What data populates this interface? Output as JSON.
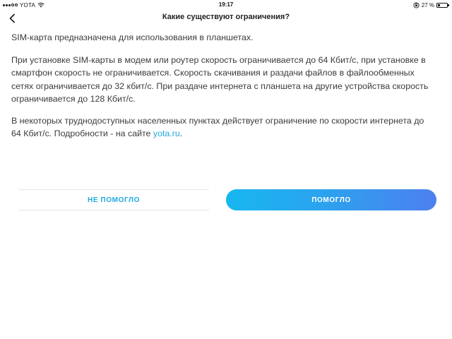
{
  "status_bar": {
    "carrier": "YOTA",
    "time": "19:17",
    "battery_percent": "27 %",
    "battery_level": 0.27,
    "icons": [
      "signal-dots-icon",
      "wifi-icon",
      "orientation-lock-icon",
      "battery-icon"
    ]
  },
  "nav": {
    "title": "Какие существуют ограничения?",
    "back_icon": "chevron-left-icon"
  },
  "content": {
    "paragraph_1": "SIM-карта предназначена для использования в планшетах.",
    "paragraph_2": "При установке SIM-карты в модем или роутер скорость ограничивается до 64 Кбит/с, при установке в смартфон скорость не ограничивается. Скорость скачивания и раздачи файлов в файлообменных сетях ограничивается до 32 кбит/с. При раздаче интернета с планшета на другие устройства скорость ограничивается до 128 Кбит/с.",
    "paragraph_3_text": "В некоторых труднодоступных населенных пунктах действует ограничение по скорости интернета до 64 Кбит/с. Подробности - на сайте ",
    "paragraph_3_link": "yota.ru",
    "paragraph_3_end": "."
  },
  "feedback": {
    "not_helped_label": "НЕ ПОМОГЛО",
    "helped_label": "ПОМОГЛО"
  },
  "colors": {
    "accent": "#1fa9e0",
    "button_gradient_start": "#17b7f0",
    "button_gradient_end": "#4d7ff0",
    "text": "#3b3b3b"
  }
}
